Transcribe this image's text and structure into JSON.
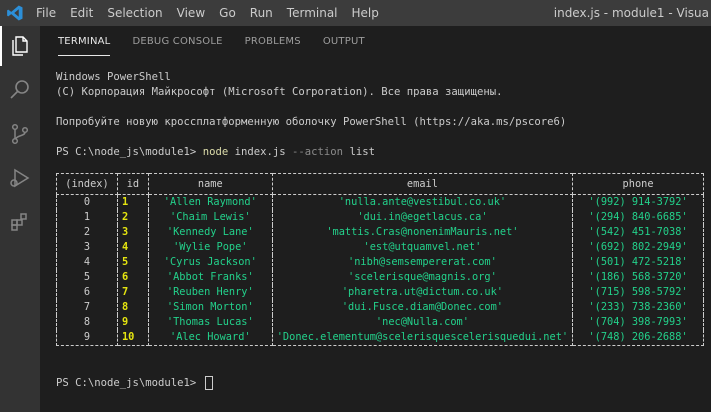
{
  "window": {
    "title": "index.js - module1 - Visua",
    "menu": [
      "File",
      "Edit",
      "Selection",
      "View",
      "Go",
      "Run",
      "Terminal",
      "Help"
    ]
  },
  "activity_bar": {
    "icons": [
      "files-icon",
      "search-icon",
      "source-control-icon",
      "run-debug-icon",
      "extensions-icon"
    ]
  },
  "panel": {
    "tabs": [
      "TERMINAL",
      "DEBUG CONSOLE",
      "PROBLEMS",
      "OUTPUT"
    ],
    "active_tab": "TERMINAL"
  },
  "terminal": {
    "banner": [
      "Windows PowerShell",
      "(C) Корпорация Майкрософт (Microsoft Corporation). Все права защищены.",
      "",
      "Попробуйте новую кроссплатформенную оболочку PowerShell (https://aka.ms/pscore6)"
    ],
    "prompt": "PS C:\\node_js\\module1> ",
    "command": {
      "program": "node",
      "file": "index.js",
      "flag": "--action",
      "value": "list"
    },
    "table": {
      "headers": [
        "(index)",
        "id",
        "name",
        "email",
        "phone"
      ],
      "rows": [
        [
          "0",
          "1",
          "'Allen Raymond'",
          "'nulla.ante@vestibul.co.uk'",
          "'(992) 914-3792'"
        ],
        [
          "1",
          "2",
          "'Chaim Lewis'",
          "'dui.in@egetlacus.ca'",
          "'(294) 840-6685'"
        ],
        [
          "2",
          "3",
          "'Kennedy Lane'",
          "'mattis.Cras@nonenimMauris.net'",
          "'(542) 451-7038'"
        ],
        [
          "3",
          "4",
          "'Wylie Pope'",
          "'est@utquamvel.net'",
          "'(692) 802-2949'"
        ],
        [
          "4",
          "5",
          "'Cyrus Jackson'",
          "'nibh@semsempererat.com'",
          "'(501) 472-5218'"
        ],
        [
          "5",
          "6",
          "'Abbot Franks'",
          "'scelerisque@magnis.org'",
          "'(186) 568-3720'"
        ],
        [
          "6",
          "7",
          "'Reuben Henry'",
          "'pharetra.ut@dictum.co.uk'",
          "'(715) 598-5792'"
        ],
        [
          "7",
          "8",
          "'Simon Morton'",
          "'dui.Fusce.diam@Donec.com'",
          "'(233) 738-2360'"
        ],
        [
          "8",
          "9",
          "'Thomas Lucas'",
          "'nec@Nulla.com'",
          "'(704) 398-7993'"
        ],
        [
          "9",
          "10",
          "'Alec Howard'",
          "'Donec.elementum@scelerisquescelerisquedui.net'",
          "'(748) 206-2688'"
        ]
      ]
    },
    "final_prompt": "PS C:\\node_js\\module1> "
  },
  "colors": {
    "background": "#1e1e1e",
    "titlebar": "#3c3c3c",
    "activity_bar": "#333333",
    "string_green": "#23d18b",
    "id_yellow": "#e5e510",
    "command_yellow": "#dcdcaa"
  }
}
